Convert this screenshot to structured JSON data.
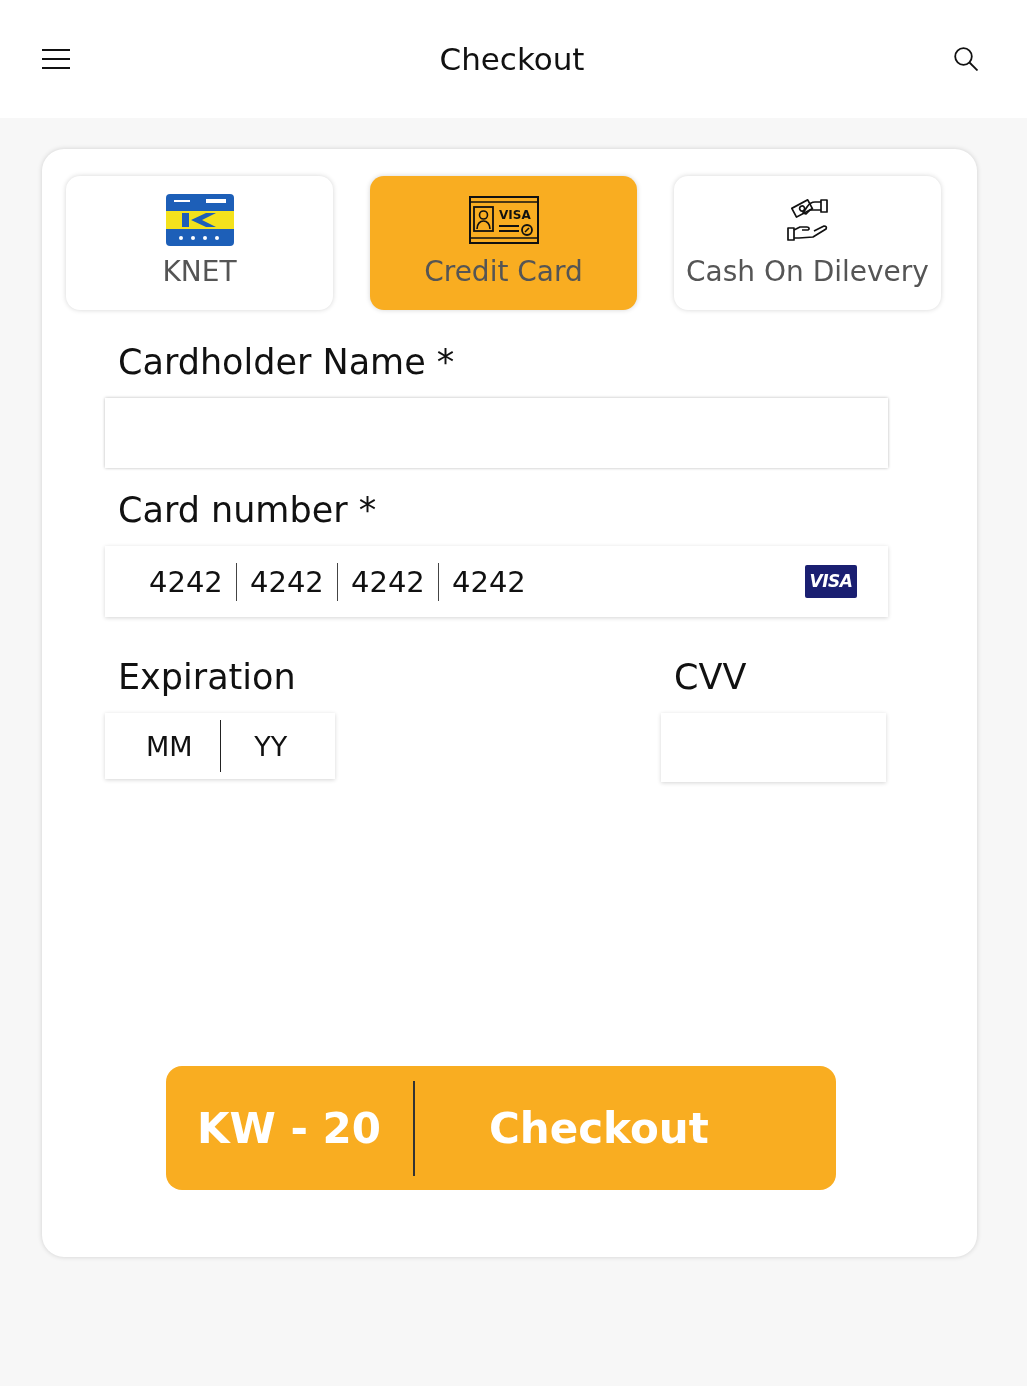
{
  "header": {
    "title": "Checkout"
  },
  "payment_methods": [
    {
      "kind": "knet",
      "label": "KNET",
      "selected": false
    },
    {
      "kind": "card",
      "label": "Credit Card",
      "icon_text": "VISA",
      "selected": true
    },
    {
      "kind": "cash",
      "label": "Cash On Dilevery",
      "selected": false
    }
  ],
  "form": {
    "fields": [
      {
        "kind": "text",
        "label": "Cardholder Name *"
      },
      {
        "kind": "card_number",
        "label": "Card number *",
        "groups": [
          "4242",
          "4242",
          "4242",
          "4242"
        ],
        "brand": "VISA"
      },
      {
        "kind": "expiry",
        "label": "Expiration",
        "placeholders": [
          "MM",
          "YY"
        ]
      },
      {
        "kind": "cvv",
        "label": "CVV"
      }
    ]
  },
  "checkout": {
    "price": "KW - 20",
    "label": "Checkout"
  }
}
